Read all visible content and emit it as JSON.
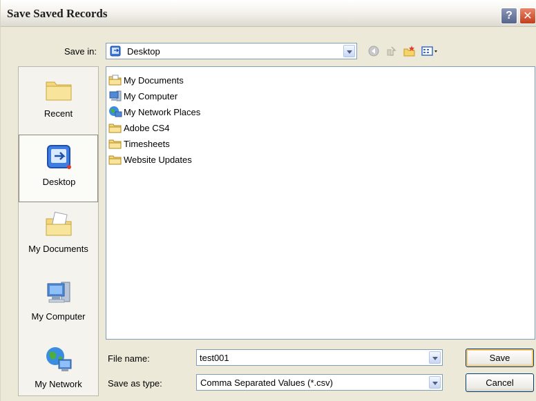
{
  "window": {
    "title": "Save Saved Records",
    "help_symbol": "?",
    "close_symbol": "✕"
  },
  "toolbar": {
    "save_in_label": "Save in:",
    "save_in_value": "Desktop",
    "icons": [
      "back-icon",
      "up-folder-icon",
      "new-folder-icon",
      "views-menu-icon"
    ]
  },
  "places": [
    {
      "label": "Recent",
      "icon": "recent-folder-icon",
      "selected": false
    },
    {
      "label": "Desktop",
      "icon": "desktop-icon",
      "selected": true
    },
    {
      "label": "My Documents",
      "icon": "my-documents-icon",
      "selected": false
    },
    {
      "label": "My Computer",
      "icon": "my-computer-icon",
      "selected": false
    },
    {
      "label": "My Network",
      "icon": "my-network-icon",
      "selected": false
    }
  ],
  "files": [
    {
      "name": "My Documents",
      "icon": "documents-folder-icon"
    },
    {
      "name": "My Computer",
      "icon": "computer-icon"
    },
    {
      "name": "My Network Places",
      "icon": "network-icon"
    },
    {
      "name": "Adobe CS4",
      "icon": "folder-icon"
    },
    {
      "name": "Timesheets",
      "icon": "folder-icon"
    },
    {
      "name": "Website Updates",
      "icon": "folder-icon"
    }
  ],
  "form": {
    "file_name_label": "File name:",
    "file_name_value": "test001",
    "save_type_label": "Save as type:",
    "save_type_value": "Comma Separated Values (*.csv)"
  },
  "buttons": {
    "save": "Save",
    "cancel": "Cancel"
  }
}
